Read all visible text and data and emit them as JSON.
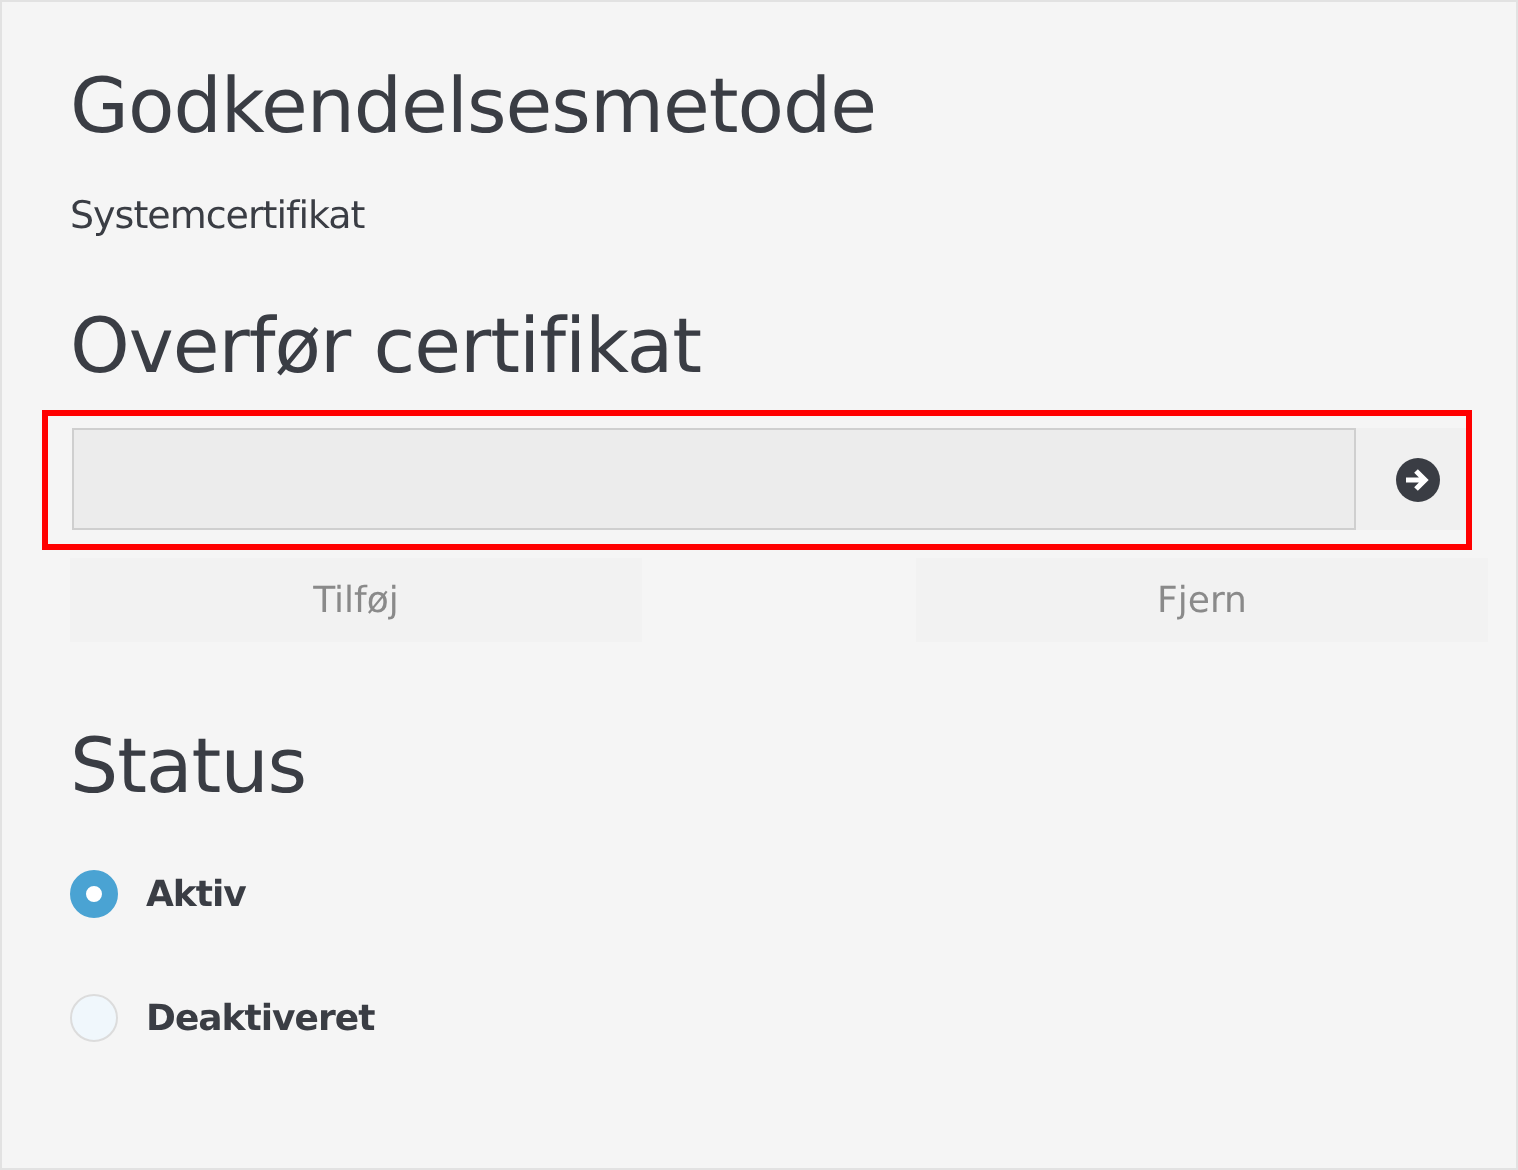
{
  "auth_method": {
    "heading": "Godkendelsesmetode",
    "value": "Systemcertifikat"
  },
  "upload": {
    "heading": "Overfør certifikat",
    "actions": [
      {
        "label": "Tilføj"
      },
      {
        "label": "Fjern"
      }
    ]
  },
  "status": {
    "heading": "Status",
    "options": [
      {
        "label": "Aktiv",
        "selected": true
      },
      {
        "label": "Deaktiveret",
        "selected": false
      }
    ]
  }
}
